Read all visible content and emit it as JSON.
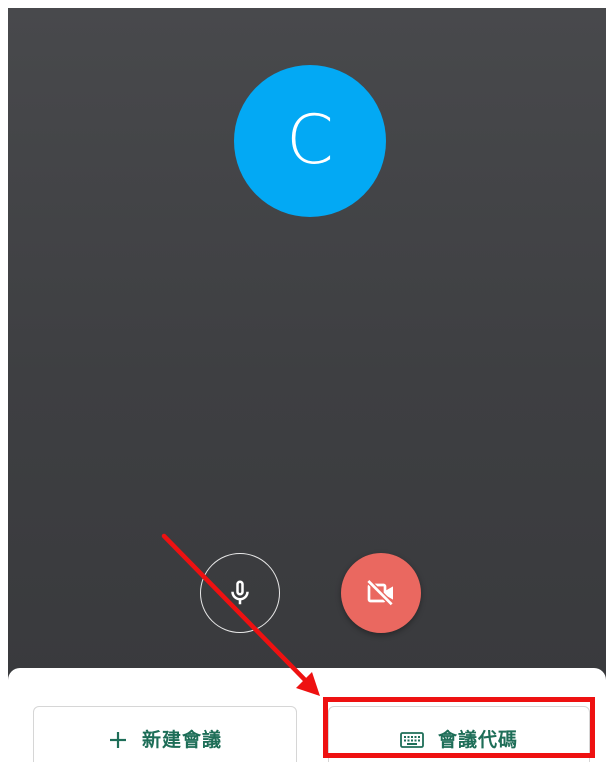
{
  "preview": {
    "avatar_letter": "C",
    "avatar_color": "#03a9f4"
  },
  "controls": {
    "mic_icon": "mic-icon",
    "camera_icon": "videocam-off-icon",
    "camera_off_color": "#ea6860"
  },
  "actions": {
    "new_meeting": {
      "label": "新建會議",
      "icon": "plus-icon"
    },
    "meeting_code": {
      "label": "會議代碼",
      "icon": "keyboard-icon"
    }
  },
  "annotation": {
    "color": "#ee1111"
  }
}
